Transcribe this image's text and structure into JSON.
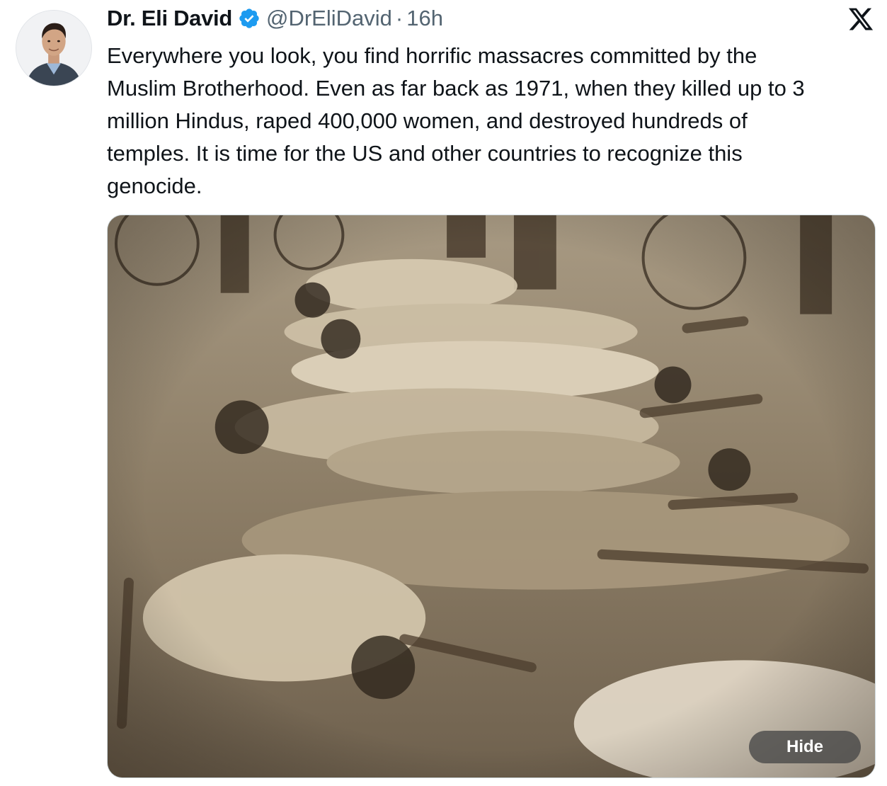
{
  "author": {
    "display_name": "Dr. Eli David",
    "handle": "@DrEliDavid",
    "separator": "·",
    "time": "16h",
    "verified": true,
    "avatar_icon": "user-avatar-photo"
  },
  "brand": {
    "logo_icon": "x-logo-icon",
    "verified_color": "#1d9bf0"
  },
  "tweet": {
    "text_lines": [
      "Everywhere you look, you find horrific massacres committed by the",
      "Muslim Brotherhood. Even as far back as 1971, when they killed up to 3",
      "million Hindus, raped 400,000 women, and destroyed hundreds of",
      "temples. It is time for the US and other countries to recognize this",
      "genocide."
    ]
  },
  "media": {
    "kind": "sepia historical photograph",
    "hide_label": "Hide"
  }
}
